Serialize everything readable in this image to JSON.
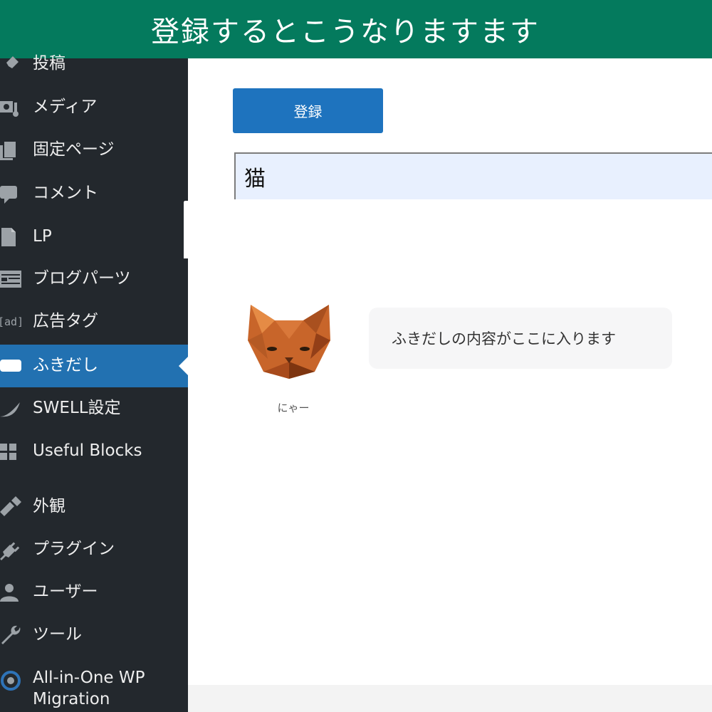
{
  "banner": {
    "text": "登録するとこうなりますます"
  },
  "sidebar": {
    "items": [
      {
        "label": "投稿",
        "icon": "pin-icon"
      },
      {
        "label": "メディア",
        "icon": "media-icon"
      },
      {
        "label": "固定ページ",
        "icon": "pages-icon"
      },
      {
        "label": "コメント",
        "icon": "comment-icon"
      },
      {
        "label": "LP",
        "icon": "document-icon"
      },
      {
        "label": "ブログパーツ",
        "icon": "layout-icon"
      },
      {
        "label": "広告タグ",
        "icon": "ad-icon",
        "icon_text": "[ad]"
      },
      {
        "label": "ふきだし",
        "icon": "speech-bubble-icon",
        "active": true
      },
      {
        "label": "SWELL設定",
        "icon": "swell-icon"
      },
      {
        "label": "Useful Blocks",
        "icon": "grid-icon"
      },
      {
        "label": "外観",
        "icon": "brush-icon"
      },
      {
        "label": "プラグイン",
        "icon": "plugin-icon"
      },
      {
        "label": "ユーザー",
        "icon": "user-icon"
      },
      {
        "label": "ツール",
        "icon": "wrench-icon"
      },
      {
        "label": "All-in-One WP Migration",
        "label_line1": "All-in-One WP",
        "label_line2": "Migration",
        "icon": "migration-icon"
      }
    ]
  },
  "main": {
    "register_button": "登録",
    "name_input_value": "猫",
    "preview": {
      "avatar_name": "にゃー",
      "bubble_text": "ふきだしの内容がここに入ります"
    }
  },
  "colors": {
    "banner_bg": "#047a5d",
    "sidebar_bg": "#23282d",
    "active_bg": "#2271b1",
    "button_bg": "#1e73be",
    "input_bg": "#e8f0fe",
    "bubble_bg": "#f6f6f7"
  }
}
